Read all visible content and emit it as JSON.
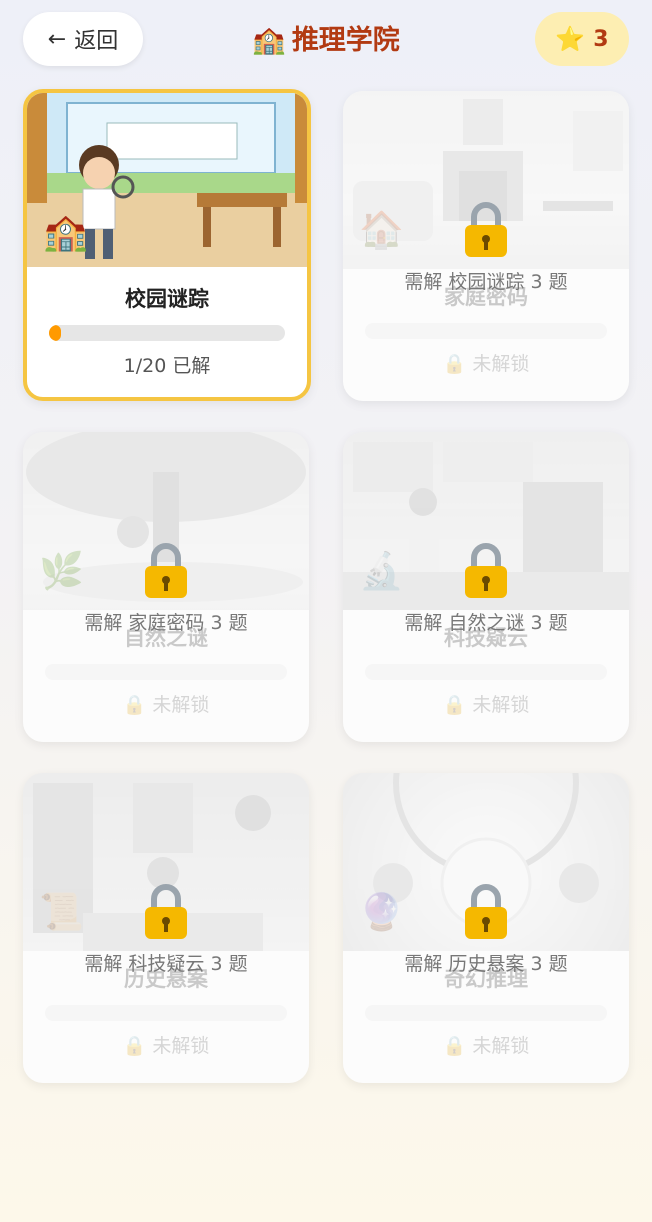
{
  "header": {
    "back_label": "返回",
    "back_arrow": "←",
    "title_emoji": "🏫",
    "title": "推理学院",
    "star_icon": "⭐",
    "star_count": "3"
  },
  "colors": {
    "accent": "#b23a12",
    "progress": "#ff9a00",
    "unlocked_border": "#f5c542",
    "badge_bg": "#fdeeb2"
  },
  "cards": [
    {
      "name": "校园谜踪",
      "icon": "🏫",
      "status": "1/20 已解",
      "progress": 0.05,
      "locked": false
    },
    {
      "name": "家庭密码",
      "icon": "🏠",
      "status": "未解锁",
      "lock_icon": "🔒",
      "requirement": "需解 校园谜踪 3 题",
      "progress": 0,
      "locked": true
    },
    {
      "name": "自然之谜",
      "icon": "🌿",
      "status": "未解锁",
      "lock_icon": "🔒",
      "requirement": "需解 家庭密码 3 题",
      "progress": 0,
      "locked": true
    },
    {
      "name": "科技疑云",
      "icon": "🔬",
      "status": "未解锁",
      "lock_icon": "🔒",
      "requirement": "需解 自然之谜 3 题",
      "progress": 0,
      "locked": true
    },
    {
      "name": "历史悬案",
      "icon": "📜",
      "status": "未解锁",
      "lock_icon": "🔒",
      "requirement": "需解 科技疑云 3 题",
      "progress": 0,
      "locked": true
    },
    {
      "name": "奇幻推理",
      "icon": "🔮",
      "status": "未解锁",
      "lock_icon": "🔒",
      "requirement": "需解 历史悬案 3 题",
      "progress": 0,
      "locked": true
    }
  ]
}
